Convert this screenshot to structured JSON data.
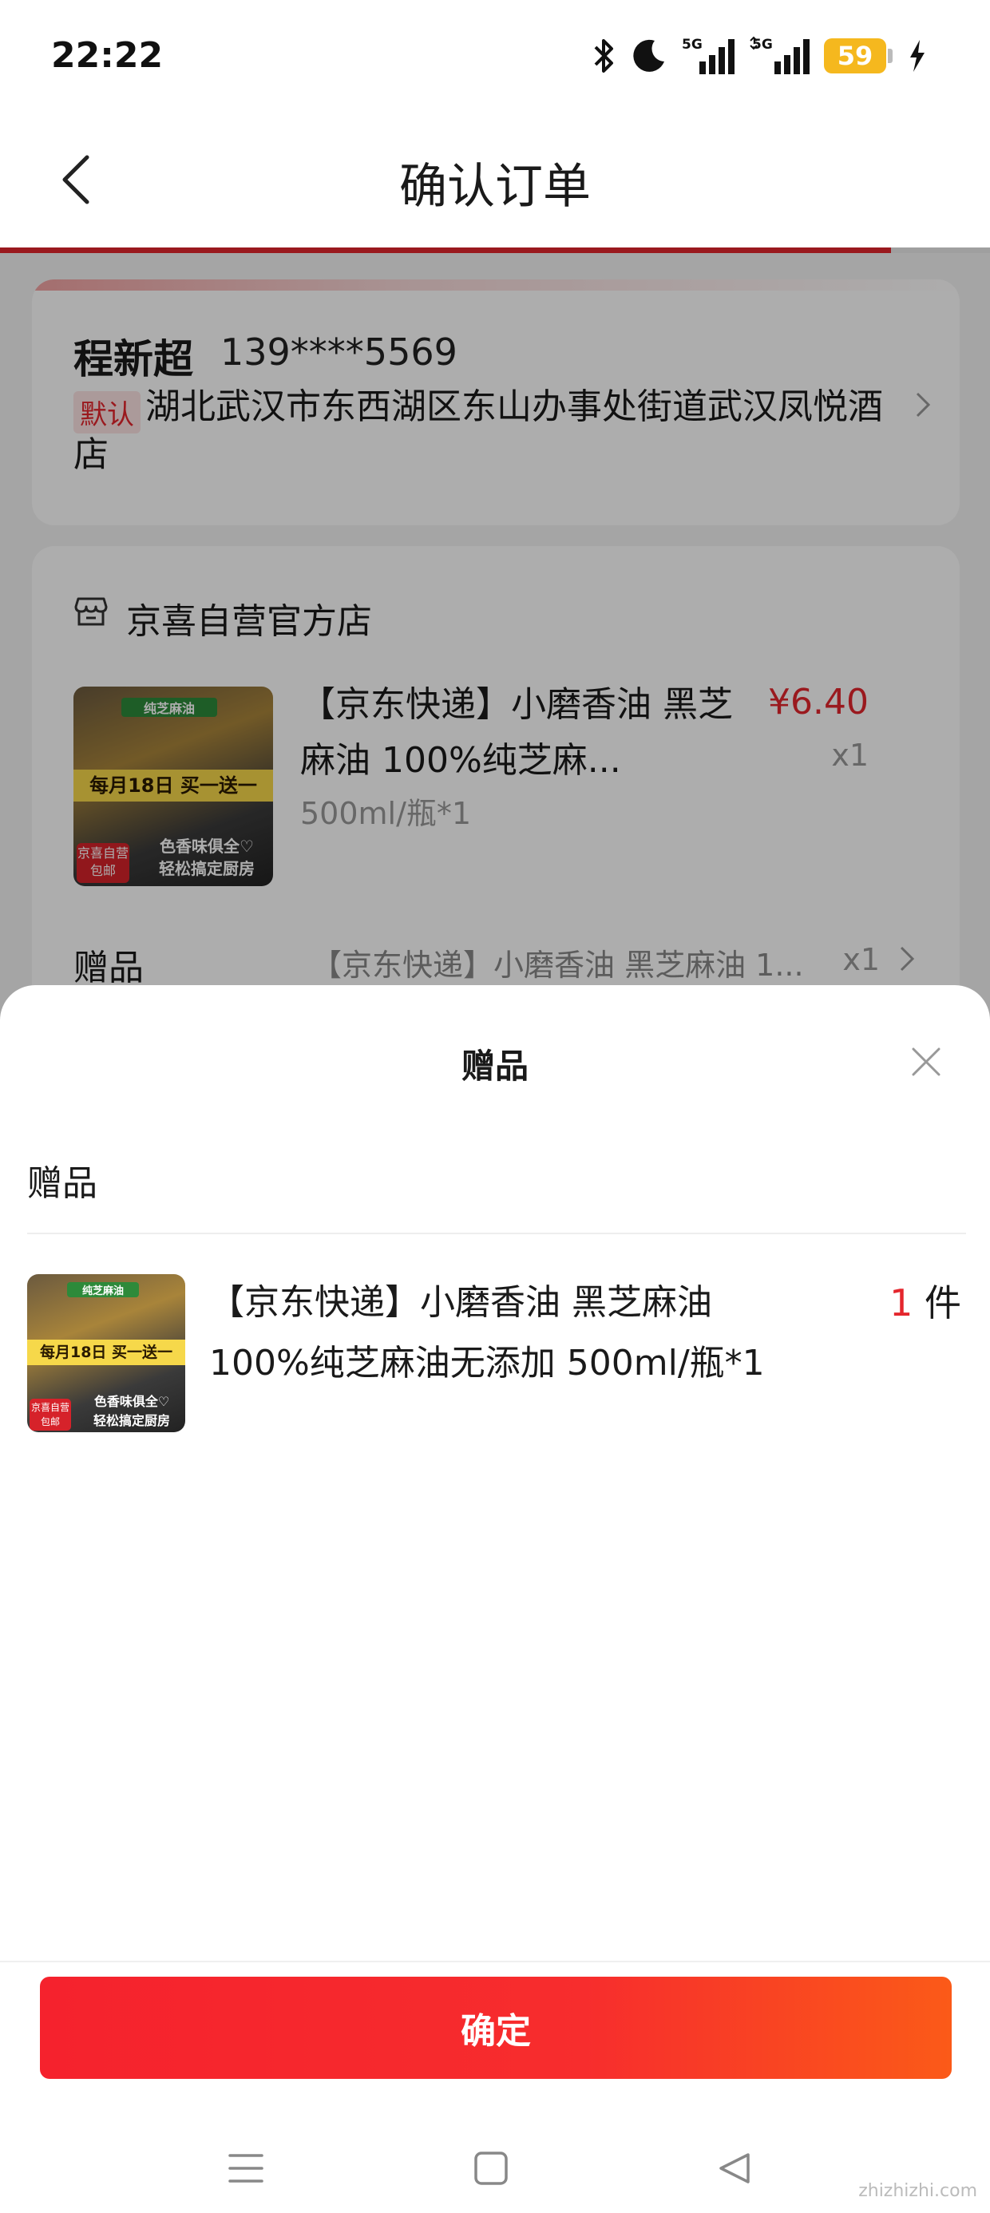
{
  "status_bar": {
    "time": "22:22",
    "network_label_1": "5G",
    "network_label_2": "5G",
    "battery_level": "59",
    "icons": [
      "bluetooth-icon",
      "moon-icon",
      "signal-icon",
      "signal-icon",
      "battery-icon",
      "charging-icon"
    ]
  },
  "nav": {
    "back_icon": "chevron-left-icon",
    "title": "确认订单",
    "progress_fraction": 0.9
  },
  "address": {
    "name": "程新超",
    "phone": "139****5569",
    "default_badge": "默认",
    "full_address": "湖北武汉市东西湖区东山办事处街道武汉凤悦酒店"
  },
  "store": {
    "icon": "store-icon",
    "name": "京喜自营官方店"
  },
  "product": {
    "title": "【京东快递】小磨香油 黑芝麻油 100%纯芝麻...",
    "spec": "500ml/瓶*1",
    "price": "¥6.40",
    "quantity": "x1",
    "image": {
      "tag_top": "纯芝麻油",
      "promo": "每月18日 买一送一",
      "badge": "京喜自营 包邮",
      "slogan_1": "色香味俱全♡",
      "slogan_2": "轻松搞定厨房"
    }
  },
  "gift_row": {
    "label": "赠品",
    "name": "【京东快递】小磨香油 黑芝麻油 1...",
    "quantity": "x1"
  },
  "sheet": {
    "title": "赠品",
    "section_label": "赠品",
    "gift_title": "【京东快递】小磨香油 黑芝麻油 100%纯芝麻油无添加 500ml/瓶*1",
    "gift_qty_num": "1",
    "gift_qty_unit": "件",
    "confirm_label": "确定"
  },
  "system_nav": {
    "icons": [
      "menu-icon",
      "home-square-icon",
      "back-triangle-icon"
    ]
  },
  "watermark": "zhizhizhi.com",
  "colors": {
    "accent": "#e4262d",
    "price": "#e4262d",
    "battery": "#f5b81e"
  }
}
